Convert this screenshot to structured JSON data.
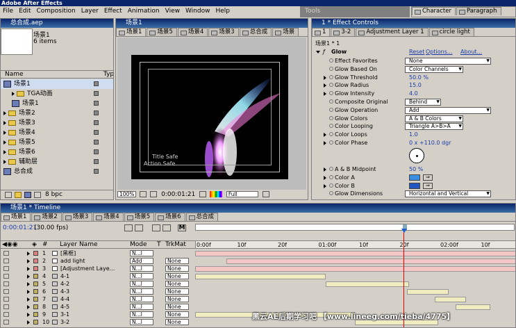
{
  "app_title": "Adobe After Effects",
  "menu": [
    "File",
    "Edit",
    "Composition",
    "Layer",
    "Effect",
    "Animation",
    "View",
    "Window",
    "Help"
  ],
  "tools_title": "Tools",
  "character_tabs": [
    "Character",
    "Paragraph"
  ],
  "project": {
    "title": "总合成.aep",
    "selected_name": "场景1",
    "selected_info": "6 items",
    "col_name": "Name",
    "col_type": "Typ",
    "items": [
      {
        "label": "场景1",
        "kind": "comp",
        "selected": true
      },
      {
        "label": "TGA动画",
        "kind": "folder",
        "indent": 1
      },
      {
        "label": "场景1",
        "kind": "comp",
        "indent": 1
      },
      {
        "label": "场景2",
        "kind": "folder"
      },
      {
        "label": "场景3",
        "kind": "folder"
      },
      {
        "label": "场景4",
        "kind": "folder"
      },
      {
        "label": "场景5",
        "kind": "folder"
      },
      {
        "label": "场景6",
        "kind": "folder"
      },
      {
        "label": "辅助层",
        "kind": "folder"
      },
      {
        "label": "总合成",
        "kind": "comp"
      }
    ],
    "bpc": "8 bpc"
  },
  "comp_viewer": {
    "title": "场景1",
    "tabs": [
      "场景1",
      "场景5",
      "场景4",
      "场景3",
      "总合成",
      "场景"
    ],
    "title_safe": "Title Safe",
    "action_safe": "Action Safe",
    "zoom": "100%",
    "timecode": "0:00:01:21",
    "resolution": "Full"
  },
  "effect_controls": {
    "title": "1 * Effect Controls",
    "tabs": [
      "1",
      "3-2",
      "Adjustment Layer 1",
      "circle light"
    ],
    "breadcrumb": "场景1 * 1",
    "effect_name": "Glow",
    "reset": "Reset",
    "options": "Options...",
    "about": "About...",
    "rows": [
      {
        "label": "Effect Favorites",
        "kind": "dropdown",
        "value": "None"
      },
      {
        "label": "Glow Based On",
        "kind": "dropdown",
        "value": "Color Channels"
      },
      {
        "label": "Glow Threshold",
        "kind": "value",
        "value": "50.0 %"
      },
      {
        "label": "Glow Radius",
        "kind": "value",
        "value": "15.0"
      },
      {
        "label": "Glow Intensity",
        "kind": "value",
        "value": "4.0"
      },
      {
        "label": "Composite Original",
        "kind": "dropdown",
        "value": "Behind"
      },
      {
        "label": "Glow Operation",
        "kind": "dropdown",
        "value": "Add"
      },
      {
        "label": "Glow Colors",
        "kind": "dropdown",
        "value": "A & B Colors"
      },
      {
        "label": "Color Looping",
        "kind": "dropdown",
        "value": "Triangle A>B>A"
      },
      {
        "label": "Color Loops",
        "kind": "value",
        "value": "1.0"
      },
      {
        "label": "Color Phase",
        "kind": "value",
        "value": "0 x +110.0 dgr"
      }
    ],
    "rows2": [
      {
        "label": "A & B Midpoint",
        "kind": "value",
        "value": "50 %"
      },
      {
        "label": "Color A",
        "kind": "color",
        "value": "#3b8fe0"
      },
      {
        "label": "Color B",
        "kind": "color",
        "value": "#2255c0"
      },
      {
        "label": "Glow Dimensions",
        "kind": "dropdown",
        "value": "Horizontal and Vertical"
      }
    ]
  },
  "timeline": {
    "title": "场景1 * Timeline",
    "tabs": [
      "场景1",
      "场景2",
      "场景3",
      "场景4",
      "场景5",
      "场景6",
      "总合成"
    ],
    "timecode": "0:00:01:21",
    "fps": "(30.00 fps)",
    "col_layer_name": "Layer Name",
    "col_mode": "Mode",
    "col_t": "T",
    "col_trkmat": "TrkMat",
    "ruler": [
      "0:00f",
      "10f",
      "20f",
      "01:00f",
      "10f",
      "20f",
      "02:00f",
      "10f"
    ],
    "layers": [
      {
        "num": "1",
        "name": "[黑框]",
        "mode": "N...l",
        "trkmat": ""
      },
      {
        "num": "2",
        "name": "add light",
        "mode": "Add",
        "trkmat": "None"
      },
      {
        "num": "3",
        "name": "[Adjustment Laye...",
        "mode": "N...l",
        "trkmat": "None"
      },
      {
        "num": "4",
        "name": "4-1",
        "mode": "N...l",
        "trkmat": "None"
      },
      {
        "num": "5",
        "name": "4-2",
        "mode": "N...l",
        "trkmat": "None"
      },
      {
        "num": "6",
        "name": "4-3",
        "mode": "N...l",
        "trkmat": "None"
      },
      {
        "num": "7",
        "name": "4-4",
        "mode": "N...l",
        "trkmat": "None"
      },
      {
        "num": "8",
        "name": "4-5",
        "mode": "N...l",
        "trkmat": "None"
      },
      {
        "num": "9",
        "name": "3-1",
        "mode": "N...l",
        "trkmat": "None"
      },
      {
        "num": "10",
        "name": "3-2",
        "mode": "N...l",
        "trkmat": "None"
      }
    ],
    "watermark": "黑云AE后期学习吧 【www.lineeg.com/tieba/4775】"
  }
}
